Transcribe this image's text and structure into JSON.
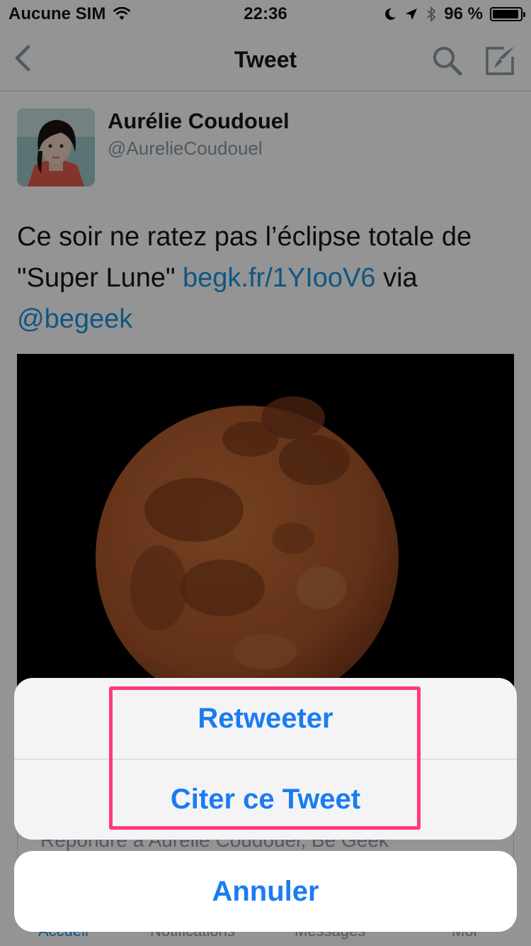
{
  "status_bar": {
    "carrier": "Aucune SIM",
    "time": "22:36",
    "battery_text": "96 %",
    "battery_level": 0.96
  },
  "nav": {
    "title": "Tweet",
    "back_icon": "chevron-left-icon",
    "search_icon": "search-icon",
    "compose_icon": "compose-icon"
  },
  "tweet": {
    "author_name": "Aurélie Coudouel",
    "author_handle": "@AurelieCoudouel",
    "text_part1": "Ce soir ne ratez pas l’éclipse totale de \"Super Lune\" ",
    "link": "begk.fr/1YIooV6",
    "text_part2": " via ",
    "mention": "@begeek"
  },
  "reply": {
    "placeholder": "Répondre à Aurélie Coudouel, Be Geek"
  },
  "tabs": [
    {
      "label": "Accueil",
      "active": true
    },
    {
      "label": "Notifications",
      "active": false
    },
    {
      "label": "Messages",
      "active": false
    },
    {
      "label": "Moi",
      "active": false
    }
  ],
  "action_sheet": {
    "retweet_label": "Retweeter",
    "quote_label": "Citer ce Tweet",
    "cancel_label": "Annuler"
  },
  "colors": {
    "accent": "#1b95e0",
    "action_text": "#1a7cf0",
    "highlight": "#ff3b7a"
  }
}
